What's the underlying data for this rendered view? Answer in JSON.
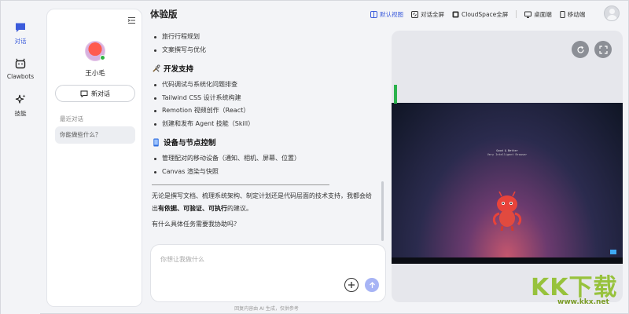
{
  "rail": {
    "items": [
      {
        "label": "对话",
        "icon": "chat-icon"
      },
      {
        "label": "Clawbots",
        "icon": "bot-icon"
      },
      {
        "label": "技能",
        "icon": "sparkle-icon"
      }
    ]
  },
  "sidebar": {
    "username": "王小毛",
    "new_chat_label": "新对话",
    "recent_title": "最近对话",
    "conversations": [
      "你能做些什么？"
    ]
  },
  "main": {
    "title": "体验版",
    "bullets_top": [
      "旅行行程规划",
      "文案撰写与优化"
    ],
    "section_dev": {
      "title": "开发支持",
      "items": [
        "代码调试与系统化问题排查",
        "Tailwind CSS 设计系统构建",
        "Remotion 视频创作（React）",
        "创建和发布 Agent 技能（Skill）"
      ]
    },
    "section_device": {
      "title": "设备与节点控制",
      "items": [
        "管理配对的移动设备（通知、相机、屏幕、位置）",
        "Canvas 渲染与快照"
      ]
    },
    "summary_pre": "无论是撰写文档、梳理系统架构、制定计划还是代码层面的技术支持，我都会给出",
    "summary_bold": "有依据、可验证、可执行",
    "summary_post": "的建议。",
    "question": "有什么具体任务需要我协助吗？",
    "input_placeholder": "你想让我做什么",
    "footer_note": "回复内容由 AI 生成，仅供参考"
  },
  "toolbar": {
    "items": [
      "默认视图",
      "对话全屏",
      "CloudSpace全屏",
      "桌面端",
      "移动端"
    ],
    "active": "默认视图"
  },
  "preview": {
    "screen_line1": "Good & Better",
    "screen_line2": "Very Intelligent Browser"
  },
  "watermark": {
    "text": "KK下载",
    "url": "www.kkx.net"
  },
  "colors": {
    "accent": "#3b5bdb",
    "send_button": "#a7b4f5",
    "online": "#2fb344",
    "watermark": "#8fbf2a"
  }
}
